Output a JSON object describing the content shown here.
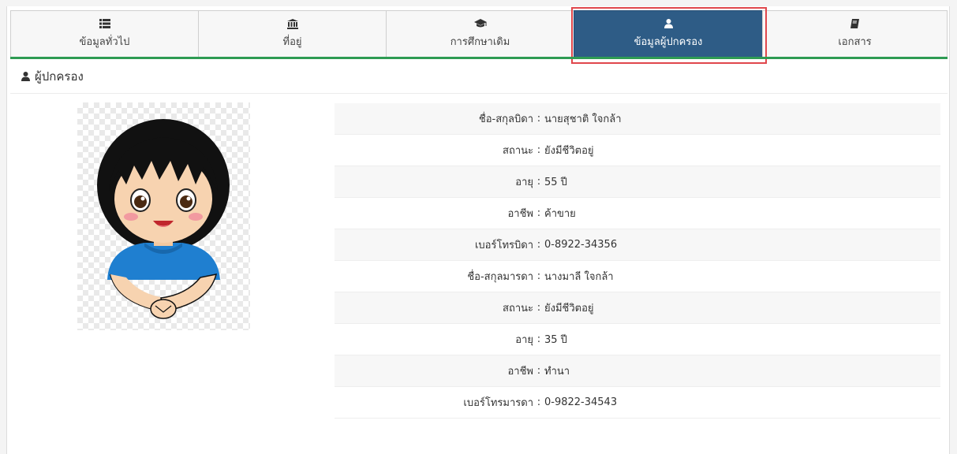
{
  "tabs": [
    {
      "label": "ข้อมูลทั่วไป",
      "icon": "list-icon",
      "active": false
    },
    {
      "label": "ที่อยู่",
      "icon": "bank-icon",
      "active": false
    },
    {
      "label": "การศึกษาเดิม",
      "icon": "graduation-cap-icon",
      "active": false
    },
    {
      "label": "ข้อมูลผู้ปกครอง",
      "icon": "user-icon",
      "active": true
    },
    {
      "label": "เอกสาร",
      "icon": "book-icon",
      "active": false
    }
  ],
  "section": {
    "title": "ผู้ปกครอง",
    "icon": "user-icon"
  },
  "avatar": {
    "icon": "cartoon-girl-avatar"
  },
  "separator": ":",
  "rows": [
    {
      "label": "ชื่อ-สกุลบิดา",
      "value": "นายสุชาติ ใจกล้า"
    },
    {
      "label": "สถานะ",
      "value": "ยังมีชีวิตอยู่"
    },
    {
      "label": "อายุ",
      "value": "55 ปี"
    },
    {
      "label": "อาชีพ",
      "value": "ค้าขาย"
    },
    {
      "label": "เบอร์โทรบิดา",
      "value": "0-8922-34356"
    },
    {
      "label": "ชื่อ-สกุลมารดา",
      "value": "นางมาลี ใจกล้า"
    },
    {
      "label": "สถานะ",
      "value": "ยังมีชีวิตอยู่"
    },
    {
      "label": "อายุ",
      "value": "35 ปี"
    },
    {
      "label": "อาชีพ",
      "value": "ทำนา"
    },
    {
      "label": "เบอร์โทรมารดา",
      "value": "0-9822-34543"
    }
  ],
  "colors": {
    "active_tab": "#2e5c86",
    "accent_rule": "#2e9b53",
    "highlight_box": "#e0474c"
  }
}
